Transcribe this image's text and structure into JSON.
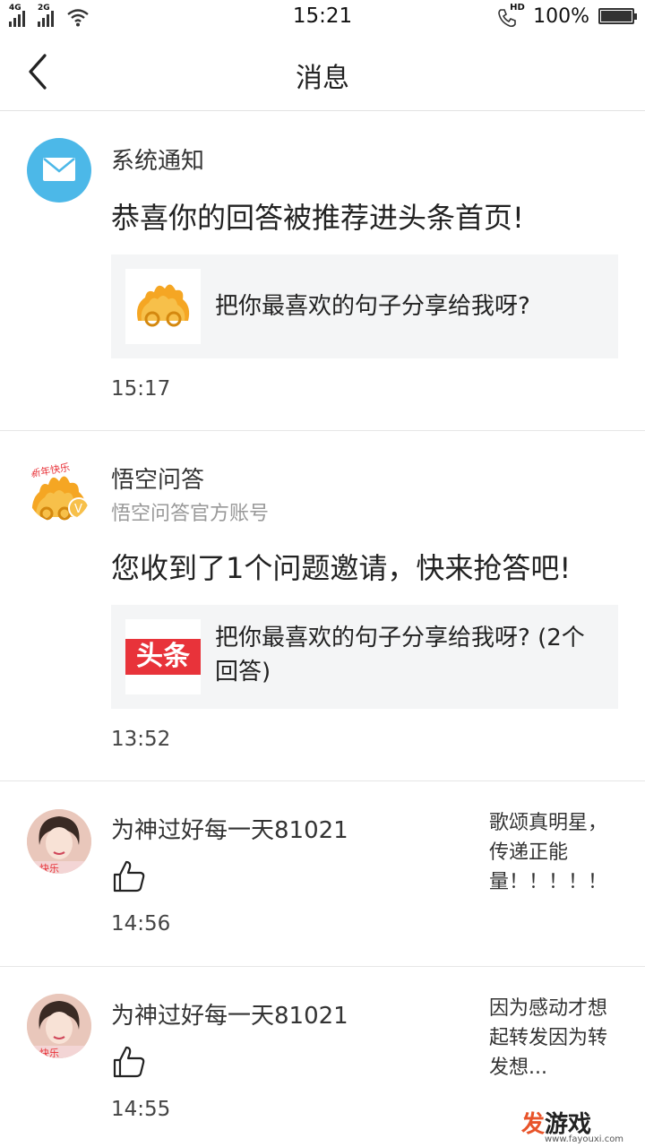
{
  "status_bar": {
    "signal1": "4G",
    "signal2": "2G",
    "time": "15:21",
    "hd": "HD",
    "battery": "100%"
  },
  "header": {
    "title": "消息"
  },
  "messages": [
    {
      "name": "系统通知",
      "body": "恭喜你的回答被推荐进头条首页!",
      "card_text": "把你最喜欢的句子分享给我呀?",
      "time": "15:17"
    },
    {
      "name": "悟空问答",
      "subtitle": "悟空问答官方账号",
      "body": "您收到了1个问题邀请，快来抢答吧!",
      "card_text": "把你最喜欢的句子分享给我呀? (2个回答)",
      "card_logo": "头条",
      "time": "13:52"
    },
    {
      "name": "为神过好每一天81021",
      "side_text": "歌颂真明星，传递正能量！！！！！",
      "time": "14:56"
    },
    {
      "name": "为神过好每一天81021",
      "side_text": "因为感动才想起转发因为转发想...",
      "time": "14:55"
    }
  ],
  "watermark": {
    "text_a": "发",
    "text_b": "游戏",
    "url": "www.fayouxi.com"
  },
  "colors": {
    "accent_blue": "#4cb8e8",
    "toutiao_red": "#e8333a",
    "card_bg": "#f4f5f6"
  }
}
